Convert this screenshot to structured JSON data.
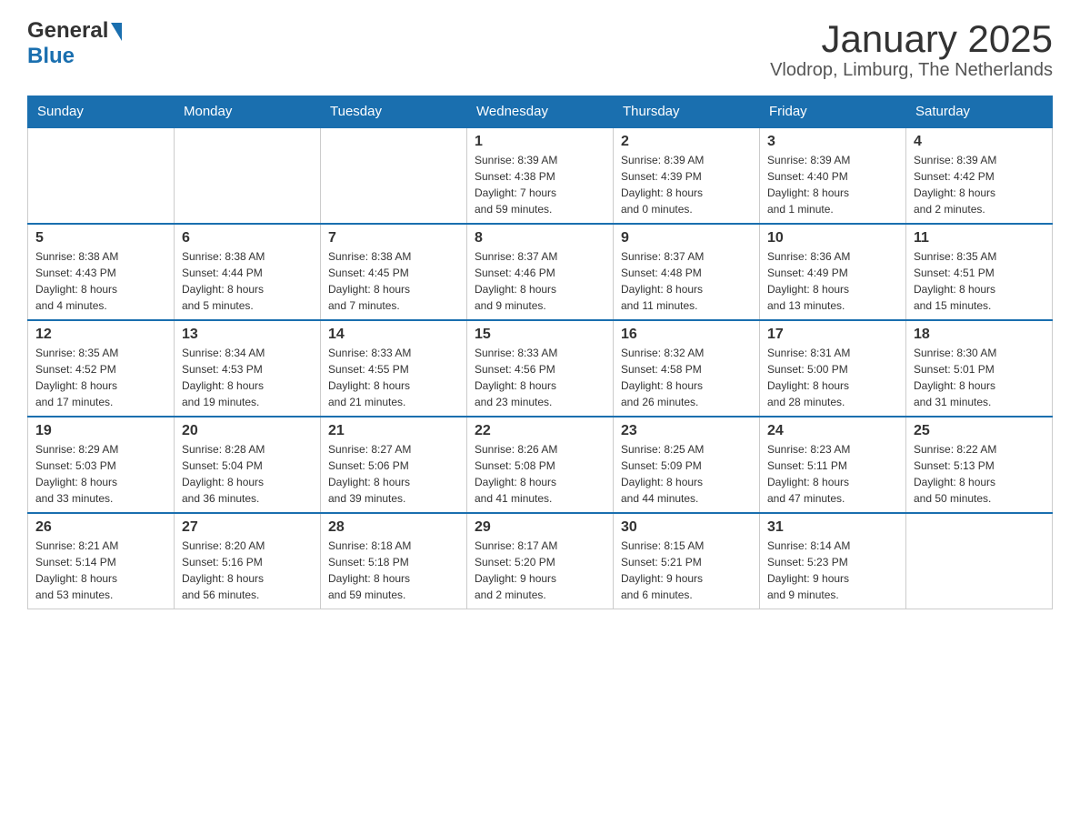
{
  "header": {
    "logo_general": "General",
    "logo_blue": "Blue",
    "title": "January 2025",
    "subtitle": "Vlodrop, Limburg, The Netherlands"
  },
  "weekdays": [
    "Sunday",
    "Monday",
    "Tuesday",
    "Wednesday",
    "Thursday",
    "Friday",
    "Saturday"
  ],
  "weeks": [
    [
      {
        "day": "",
        "info": ""
      },
      {
        "day": "",
        "info": ""
      },
      {
        "day": "",
        "info": ""
      },
      {
        "day": "1",
        "info": "Sunrise: 8:39 AM\nSunset: 4:38 PM\nDaylight: 7 hours\nand 59 minutes."
      },
      {
        "day": "2",
        "info": "Sunrise: 8:39 AM\nSunset: 4:39 PM\nDaylight: 8 hours\nand 0 minutes."
      },
      {
        "day": "3",
        "info": "Sunrise: 8:39 AM\nSunset: 4:40 PM\nDaylight: 8 hours\nand 1 minute."
      },
      {
        "day": "4",
        "info": "Sunrise: 8:39 AM\nSunset: 4:42 PM\nDaylight: 8 hours\nand 2 minutes."
      }
    ],
    [
      {
        "day": "5",
        "info": "Sunrise: 8:38 AM\nSunset: 4:43 PM\nDaylight: 8 hours\nand 4 minutes."
      },
      {
        "day": "6",
        "info": "Sunrise: 8:38 AM\nSunset: 4:44 PM\nDaylight: 8 hours\nand 5 minutes."
      },
      {
        "day": "7",
        "info": "Sunrise: 8:38 AM\nSunset: 4:45 PM\nDaylight: 8 hours\nand 7 minutes."
      },
      {
        "day": "8",
        "info": "Sunrise: 8:37 AM\nSunset: 4:46 PM\nDaylight: 8 hours\nand 9 minutes."
      },
      {
        "day": "9",
        "info": "Sunrise: 8:37 AM\nSunset: 4:48 PM\nDaylight: 8 hours\nand 11 minutes."
      },
      {
        "day": "10",
        "info": "Sunrise: 8:36 AM\nSunset: 4:49 PM\nDaylight: 8 hours\nand 13 minutes."
      },
      {
        "day": "11",
        "info": "Sunrise: 8:35 AM\nSunset: 4:51 PM\nDaylight: 8 hours\nand 15 minutes."
      }
    ],
    [
      {
        "day": "12",
        "info": "Sunrise: 8:35 AM\nSunset: 4:52 PM\nDaylight: 8 hours\nand 17 minutes."
      },
      {
        "day": "13",
        "info": "Sunrise: 8:34 AM\nSunset: 4:53 PM\nDaylight: 8 hours\nand 19 minutes."
      },
      {
        "day": "14",
        "info": "Sunrise: 8:33 AM\nSunset: 4:55 PM\nDaylight: 8 hours\nand 21 minutes."
      },
      {
        "day": "15",
        "info": "Sunrise: 8:33 AM\nSunset: 4:56 PM\nDaylight: 8 hours\nand 23 minutes."
      },
      {
        "day": "16",
        "info": "Sunrise: 8:32 AM\nSunset: 4:58 PM\nDaylight: 8 hours\nand 26 minutes."
      },
      {
        "day": "17",
        "info": "Sunrise: 8:31 AM\nSunset: 5:00 PM\nDaylight: 8 hours\nand 28 minutes."
      },
      {
        "day": "18",
        "info": "Sunrise: 8:30 AM\nSunset: 5:01 PM\nDaylight: 8 hours\nand 31 minutes."
      }
    ],
    [
      {
        "day": "19",
        "info": "Sunrise: 8:29 AM\nSunset: 5:03 PM\nDaylight: 8 hours\nand 33 minutes."
      },
      {
        "day": "20",
        "info": "Sunrise: 8:28 AM\nSunset: 5:04 PM\nDaylight: 8 hours\nand 36 minutes."
      },
      {
        "day": "21",
        "info": "Sunrise: 8:27 AM\nSunset: 5:06 PM\nDaylight: 8 hours\nand 39 minutes."
      },
      {
        "day": "22",
        "info": "Sunrise: 8:26 AM\nSunset: 5:08 PM\nDaylight: 8 hours\nand 41 minutes."
      },
      {
        "day": "23",
        "info": "Sunrise: 8:25 AM\nSunset: 5:09 PM\nDaylight: 8 hours\nand 44 minutes."
      },
      {
        "day": "24",
        "info": "Sunrise: 8:23 AM\nSunset: 5:11 PM\nDaylight: 8 hours\nand 47 minutes."
      },
      {
        "day": "25",
        "info": "Sunrise: 8:22 AM\nSunset: 5:13 PM\nDaylight: 8 hours\nand 50 minutes."
      }
    ],
    [
      {
        "day": "26",
        "info": "Sunrise: 8:21 AM\nSunset: 5:14 PM\nDaylight: 8 hours\nand 53 minutes."
      },
      {
        "day": "27",
        "info": "Sunrise: 8:20 AM\nSunset: 5:16 PM\nDaylight: 8 hours\nand 56 minutes."
      },
      {
        "day": "28",
        "info": "Sunrise: 8:18 AM\nSunset: 5:18 PM\nDaylight: 8 hours\nand 59 minutes."
      },
      {
        "day": "29",
        "info": "Sunrise: 8:17 AM\nSunset: 5:20 PM\nDaylight: 9 hours\nand 2 minutes."
      },
      {
        "day": "30",
        "info": "Sunrise: 8:15 AM\nSunset: 5:21 PM\nDaylight: 9 hours\nand 6 minutes."
      },
      {
        "day": "31",
        "info": "Sunrise: 8:14 AM\nSunset: 5:23 PM\nDaylight: 9 hours\nand 9 minutes."
      },
      {
        "day": "",
        "info": ""
      }
    ]
  ]
}
